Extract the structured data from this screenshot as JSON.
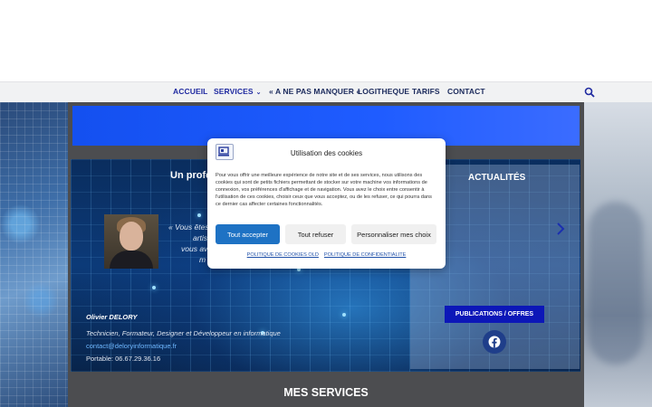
{
  "nav": {
    "items": [
      {
        "label": "ACCUEIL"
      },
      {
        "label": "SERVICES"
      },
      {
        "label": "« A NE PAS MANQUER «"
      },
      {
        "label": "LOGITHEQUE"
      },
      {
        "label": "TARIFS"
      },
      {
        "label": "CONTACT"
      }
    ],
    "search_icon": "search-icon"
  },
  "hero": {
    "title": "Un profe",
    "quote_lines": [
      "« Vous êtes",
      "artis",
      "vous av",
      "m"
    ],
    "name": "Olivier DELORY",
    "role": "Technicien, Formateur, Designer et Développeur en informatique",
    "email": "contact@deloryinformatique.fr",
    "phone": "Portable: 06.67.29.36.16"
  },
  "news": {
    "title": "ACTUALITÉS",
    "publications_button": "PUBLICATIONS / OFFRES",
    "social_icon": "facebook-icon"
  },
  "services": {
    "title": "MES SERVICES"
  },
  "cookie_modal": {
    "title": "Utilisation des cookies",
    "text": "Pour vous offrir une meilleure expérience de notre site et de ses services, nous utilisons des cookies qui sont de petits fichiers permettant de stocker sur votre machine vos informations de connexion, vos préférences d'affichage et de navigation. Vous avez le choix entre consentir à l'utilisation de ces cookies, choisir ceux que vous acceptez, ou de les refuser, ce qui pourra dans ce dernier cas affecter certaines fonctionnalités.",
    "accept_label": "Tout accepter",
    "refuse_label": "Tout refuser",
    "customize_label": "Personnaliser mes choix",
    "cookie_policy_link": "POLITIQUE DE COOKIES OLD",
    "privacy_policy_link": "POLITIQUE DE CONFIDENTIALITE"
  },
  "colors": {
    "accent_blue": "#1450f0",
    "nav_text": "#1b2a5c",
    "accept_button": "#1e72c4",
    "publications_button": "#0c17b8"
  }
}
